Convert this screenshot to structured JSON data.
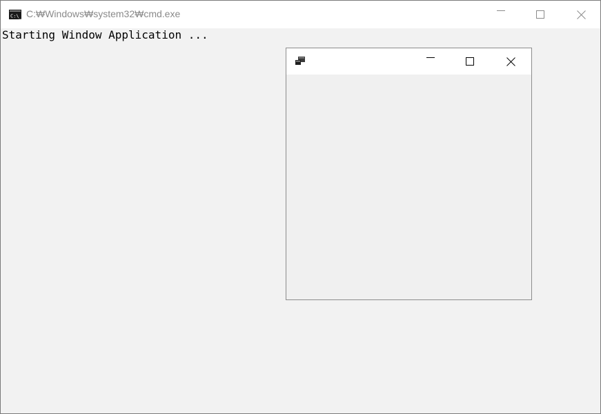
{
  "console": {
    "title": "C:₩Windows₩system32₩cmd.exe",
    "icon": "cmd-icon",
    "output": "Starting Window Application ..."
  },
  "child_window": {
    "title": "",
    "icon": "app-window-icon"
  },
  "caption_buttons": [
    "minimize-icon",
    "maximize-icon",
    "close-icon"
  ]
}
